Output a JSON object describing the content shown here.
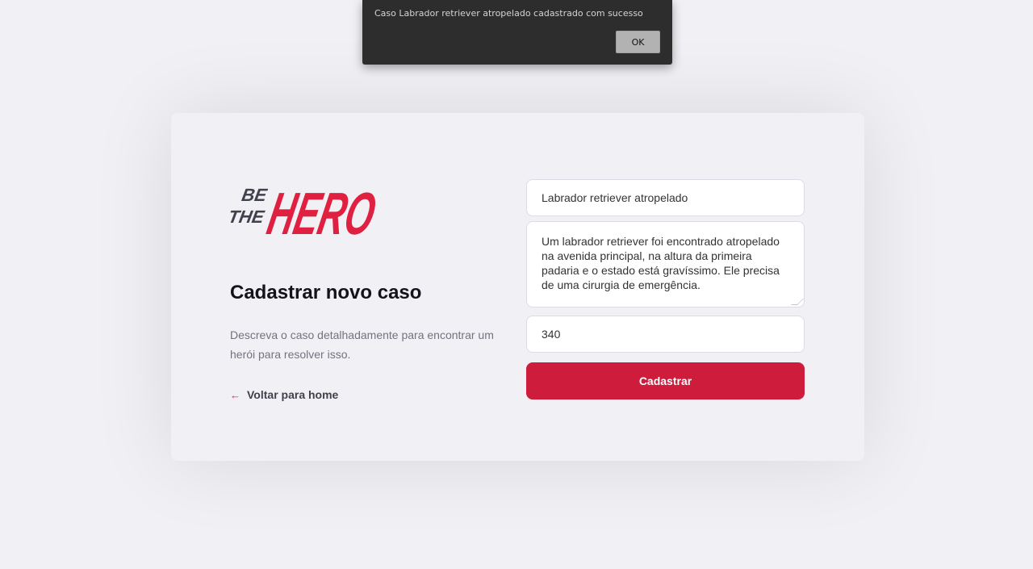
{
  "alert": {
    "message": "Caso Labrador retriever atropelado cadastrado com sucesso",
    "ok_label": "OK"
  },
  "logo": {
    "be": "BE",
    "the": "THE",
    "hero": "HERO",
    "colors": {
      "dark": "#41414d",
      "accent": "#e02041"
    }
  },
  "main": {
    "title": "Cadastrar novo caso",
    "description": "Descreva o caso detalhadamente para encontrar um herói para resolver isso.",
    "back_link": "Voltar para home",
    "back_icon": "arrow-left-icon"
  },
  "form": {
    "title_value": "Labrador retriever atropelado",
    "description_value": "Um labrador retriever foi encontrado atropelado na avenida principal, na altura da primeira padaria e o estado está gravíssimo. Ele precisa de uma cirurgia de emergência.",
    "value": "340",
    "submit_label": "Cadastrar",
    "submit_color": "#cd1c3c"
  }
}
